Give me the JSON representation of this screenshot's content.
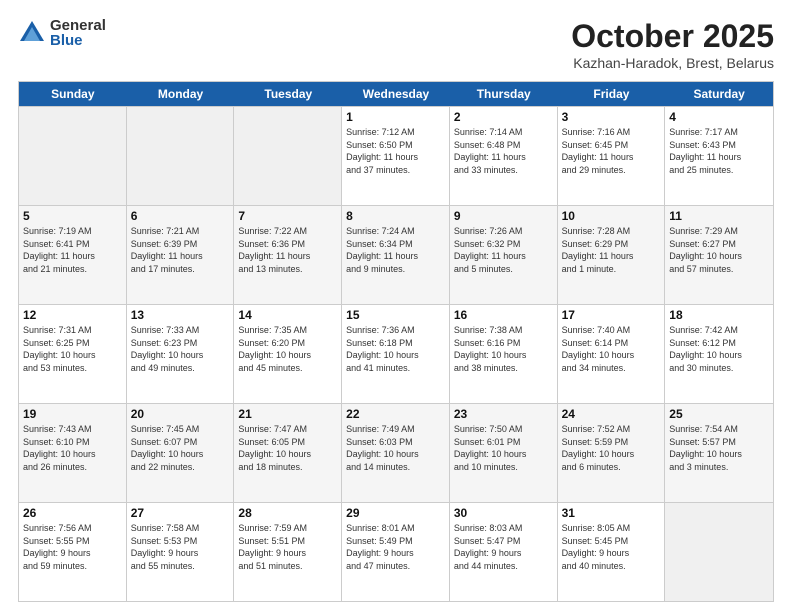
{
  "header": {
    "logo_general": "General",
    "logo_blue": "Blue",
    "title": "October 2025",
    "location": "Kazhan-Haradok, Brest, Belarus"
  },
  "days_of_week": [
    "Sunday",
    "Monday",
    "Tuesday",
    "Wednesday",
    "Thursday",
    "Friday",
    "Saturday"
  ],
  "weeks": [
    [
      {
        "day": "",
        "info": ""
      },
      {
        "day": "",
        "info": ""
      },
      {
        "day": "",
        "info": ""
      },
      {
        "day": "1",
        "info": "Sunrise: 7:12 AM\nSunset: 6:50 PM\nDaylight: 11 hours\nand 37 minutes."
      },
      {
        "day": "2",
        "info": "Sunrise: 7:14 AM\nSunset: 6:48 PM\nDaylight: 11 hours\nand 33 minutes."
      },
      {
        "day": "3",
        "info": "Sunrise: 7:16 AM\nSunset: 6:45 PM\nDaylight: 11 hours\nand 29 minutes."
      },
      {
        "day": "4",
        "info": "Sunrise: 7:17 AM\nSunset: 6:43 PM\nDaylight: 11 hours\nand 25 minutes."
      }
    ],
    [
      {
        "day": "5",
        "info": "Sunrise: 7:19 AM\nSunset: 6:41 PM\nDaylight: 11 hours\nand 21 minutes."
      },
      {
        "day": "6",
        "info": "Sunrise: 7:21 AM\nSunset: 6:39 PM\nDaylight: 11 hours\nand 17 minutes."
      },
      {
        "day": "7",
        "info": "Sunrise: 7:22 AM\nSunset: 6:36 PM\nDaylight: 11 hours\nand 13 minutes."
      },
      {
        "day": "8",
        "info": "Sunrise: 7:24 AM\nSunset: 6:34 PM\nDaylight: 11 hours\nand 9 minutes."
      },
      {
        "day": "9",
        "info": "Sunrise: 7:26 AM\nSunset: 6:32 PM\nDaylight: 11 hours\nand 5 minutes."
      },
      {
        "day": "10",
        "info": "Sunrise: 7:28 AM\nSunset: 6:29 PM\nDaylight: 11 hours\nand 1 minute."
      },
      {
        "day": "11",
        "info": "Sunrise: 7:29 AM\nSunset: 6:27 PM\nDaylight: 10 hours\nand 57 minutes."
      }
    ],
    [
      {
        "day": "12",
        "info": "Sunrise: 7:31 AM\nSunset: 6:25 PM\nDaylight: 10 hours\nand 53 minutes."
      },
      {
        "day": "13",
        "info": "Sunrise: 7:33 AM\nSunset: 6:23 PM\nDaylight: 10 hours\nand 49 minutes."
      },
      {
        "day": "14",
        "info": "Sunrise: 7:35 AM\nSunset: 6:20 PM\nDaylight: 10 hours\nand 45 minutes."
      },
      {
        "day": "15",
        "info": "Sunrise: 7:36 AM\nSunset: 6:18 PM\nDaylight: 10 hours\nand 41 minutes."
      },
      {
        "day": "16",
        "info": "Sunrise: 7:38 AM\nSunset: 6:16 PM\nDaylight: 10 hours\nand 38 minutes."
      },
      {
        "day": "17",
        "info": "Sunrise: 7:40 AM\nSunset: 6:14 PM\nDaylight: 10 hours\nand 34 minutes."
      },
      {
        "day": "18",
        "info": "Sunrise: 7:42 AM\nSunset: 6:12 PM\nDaylight: 10 hours\nand 30 minutes."
      }
    ],
    [
      {
        "day": "19",
        "info": "Sunrise: 7:43 AM\nSunset: 6:10 PM\nDaylight: 10 hours\nand 26 minutes."
      },
      {
        "day": "20",
        "info": "Sunrise: 7:45 AM\nSunset: 6:07 PM\nDaylight: 10 hours\nand 22 minutes."
      },
      {
        "day": "21",
        "info": "Sunrise: 7:47 AM\nSunset: 6:05 PM\nDaylight: 10 hours\nand 18 minutes."
      },
      {
        "day": "22",
        "info": "Sunrise: 7:49 AM\nSunset: 6:03 PM\nDaylight: 10 hours\nand 14 minutes."
      },
      {
        "day": "23",
        "info": "Sunrise: 7:50 AM\nSunset: 6:01 PM\nDaylight: 10 hours\nand 10 minutes."
      },
      {
        "day": "24",
        "info": "Sunrise: 7:52 AM\nSunset: 5:59 PM\nDaylight: 10 hours\nand 6 minutes."
      },
      {
        "day": "25",
        "info": "Sunrise: 7:54 AM\nSunset: 5:57 PM\nDaylight: 10 hours\nand 3 minutes."
      }
    ],
    [
      {
        "day": "26",
        "info": "Sunrise: 7:56 AM\nSunset: 5:55 PM\nDaylight: 9 hours\nand 59 minutes."
      },
      {
        "day": "27",
        "info": "Sunrise: 7:58 AM\nSunset: 5:53 PM\nDaylight: 9 hours\nand 55 minutes."
      },
      {
        "day": "28",
        "info": "Sunrise: 7:59 AM\nSunset: 5:51 PM\nDaylight: 9 hours\nand 51 minutes."
      },
      {
        "day": "29",
        "info": "Sunrise: 8:01 AM\nSunset: 5:49 PM\nDaylight: 9 hours\nand 47 minutes."
      },
      {
        "day": "30",
        "info": "Sunrise: 8:03 AM\nSunset: 5:47 PM\nDaylight: 9 hours\nand 44 minutes."
      },
      {
        "day": "31",
        "info": "Sunrise: 8:05 AM\nSunset: 5:45 PM\nDaylight: 9 hours\nand 40 minutes."
      },
      {
        "day": "",
        "info": ""
      }
    ]
  ]
}
